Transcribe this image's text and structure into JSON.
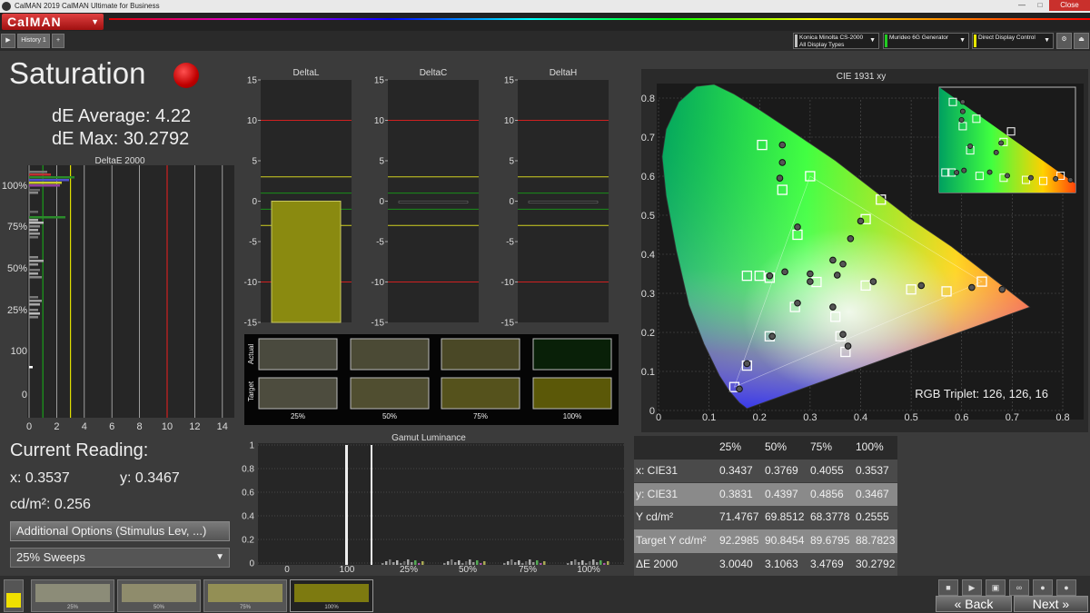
{
  "window": {
    "title": "CalMAN 2019 CalMAN Ultimate for Business",
    "close_label": "Close"
  },
  "logo": {
    "text": "CalMAN"
  },
  "tabs": {
    "history": "History 1",
    "add": "+"
  },
  "devices": [
    {
      "line1": "Konica Minolta CS-2000",
      "line2": "All Display Types",
      "color": "#c0c0c0"
    },
    {
      "line1": "Murideo 6G Generator",
      "line2": "",
      "color": "#22cc22"
    },
    {
      "line1": "Direct Display Control",
      "line2": "",
      "color": "#e6e600"
    }
  ],
  "page": {
    "title": "Saturation",
    "de_average": "dE Average: 4.22",
    "de_max": "dE Max: 30.2792"
  },
  "deltae_chart": {
    "title": "DeltaE 2000",
    "x_ticks": [
      "0",
      "2",
      "4",
      "6",
      "8",
      "10",
      "12",
      "14"
    ],
    "y_ticks": [
      "100%",
      "75%",
      "50%",
      "25%",
      "100",
      "0"
    ]
  },
  "delta_charts": [
    {
      "title": "DeltaL",
      "value": -15
    },
    {
      "title": "DeltaC",
      "value": -0.3
    },
    {
      "title": "DeltaH",
      "value": -0.3
    }
  ],
  "delta_ticks": [
    "15",
    "10",
    "5",
    "0",
    "-5",
    "-10",
    "-15"
  ],
  "swatches": {
    "actual_label": "Actual",
    "target_label": "Target",
    "labels": [
      "25%",
      "50%",
      "75%",
      "100%"
    ],
    "actual_colors": [
      "#4a4a3e",
      "#4b4a35",
      "#4a4826",
      "#092008"
    ],
    "target_colors": [
      "#4d4c3e",
      "#504e30",
      "#55521c",
      "#5b5808"
    ]
  },
  "current": {
    "heading": "Current Reading:",
    "x": "x: 0.3537",
    "y": "y: 0.3467",
    "cd": "cd/m²: 0.256"
  },
  "buttons": {
    "additional_options": "Additional Options (Stimulus Lev, ...)",
    "sweeps": "25% Sweeps"
  },
  "gamut_luminance": {
    "title": "Gamut Luminance",
    "y_ticks": [
      "1",
      "0.8",
      "0.6",
      "0.4",
      "0.2",
      "0"
    ],
    "x_ticks": [
      "0",
      "100",
      "25%",
      "50%",
      "75%",
      "100%"
    ]
  },
  "cie": {
    "title": "CIE 1931 xy",
    "x_ticks": [
      "0",
      "0.1",
      "0.2",
      "0.3",
      "0.4",
      "0.5",
      "0.6",
      "0.7",
      "0.8"
    ],
    "y_ticks": [
      "0.8",
      "0.7",
      "0.6",
      "0.5",
      "0.4",
      "0.3",
      "0.2",
      "0.1",
      "0"
    ],
    "rgb_triplet": "RGB Triplet: 126, 126, 16",
    "targets": [
      [
        0.64,
        0.33
      ],
      [
        0.3,
        0.6
      ],
      [
        0.15,
        0.06
      ],
      [
        0.3127,
        0.329
      ],
      [
        0.5,
        0.31
      ],
      [
        0.57,
        0.305
      ],
      [
        0.41,
        0.32
      ],
      [
        0.44,
        0.54
      ],
      [
        0.41,
        0.49
      ],
      [
        0.275,
        0.45
      ],
      [
        0.245,
        0.565
      ],
      [
        0.205,
        0.68
      ],
      [
        0.175,
        0.345
      ],
      [
        0.2,
        0.345
      ],
      [
        0.22,
        0.34
      ],
      [
        0.27,
        0.265
      ],
      [
        0.35,
        0.24
      ],
      [
        0.36,
        0.19
      ],
      [
        0.37,
        0.15
      ],
      [
        0.22,
        0.19
      ],
      [
        0.175,
        0.115
      ]
    ],
    "measured": [
      [
        0.68,
        0.31
      ],
      [
        0.245,
        0.68
      ],
      [
        0.16,
        0.055
      ],
      [
        0.3537,
        0.3467
      ],
      [
        0.52,
        0.32
      ],
      [
        0.62,
        0.315
      ],
      [
        0.425,
        0.33
      ],
      [
        0.4,
        0.485
      ],
      [
        0.38,
        0.44
      ],
      [
        0.275,
        0.47
      ],
      [
        0.245,
        0.635
      ],
      [
        0.24,
        0.595
      ],
      [
        0.22,
        0.345
      ],
      [
        0.25,
        0.355
      ],
      [
        0.3,
        0.35
      ],
      [
        0.275,
        0.275
      ],
      [
        0.345,
        0.265
      ],
      [
        0.365,
        0.195
      ],
      [
        0.375,
        0.165
      ],
      [
        0.225,
        0.19
      ],
      [
        0.175,
        0.12
      ],
      [
        0.345,
        0.385
      ],
      [
        0.365,
        0.375
      ],
      [
        0.3,
        0.33
      ]
    ]
  },
  "table": {
    "headers": [
      "",
      "25%",
      "50%",
      "75%",
      "100%"
    ],
    "rows": [
      [
        "x: CIE31",
        "0.3437",
        "0.3769",
        "0.4055",
        "0.3537"
      ],
      [
        "y: CIE31",
        "0.3831",
        "0.4397",
        "0.4856",
        "0.3467"
      ],
      [
        "Y cd/m²",
        "71.4767",
        "69.8512",
        "68.3778",
        "0.2555"
      ],
      [
        "Target Y cd/m²",
        "92.2985",
        "90.8454",
        "89.6795",
        "88.7823"
      ],
      [
        "ΔE 2000",
        "3.0040",
        "3.1063",
        "3.4769",
        "30.2792"
      ]
    ]
  },
  "bottom": {
    "thumbs": [
      {
        "label": "25%",
        "color": "#8c8c78"
      },
      {
        "label": "50%",
        "color": "#8f8c6c"
      },
      {
        "label": "75%",
        "color": "#938f55"
      },
      {
        "label": "100%",
        "color": "#7d7a10"
      }
    ],
    "back": "Back",
    "next": "Next",
    "current_color": "#f0e000"
  }
}
